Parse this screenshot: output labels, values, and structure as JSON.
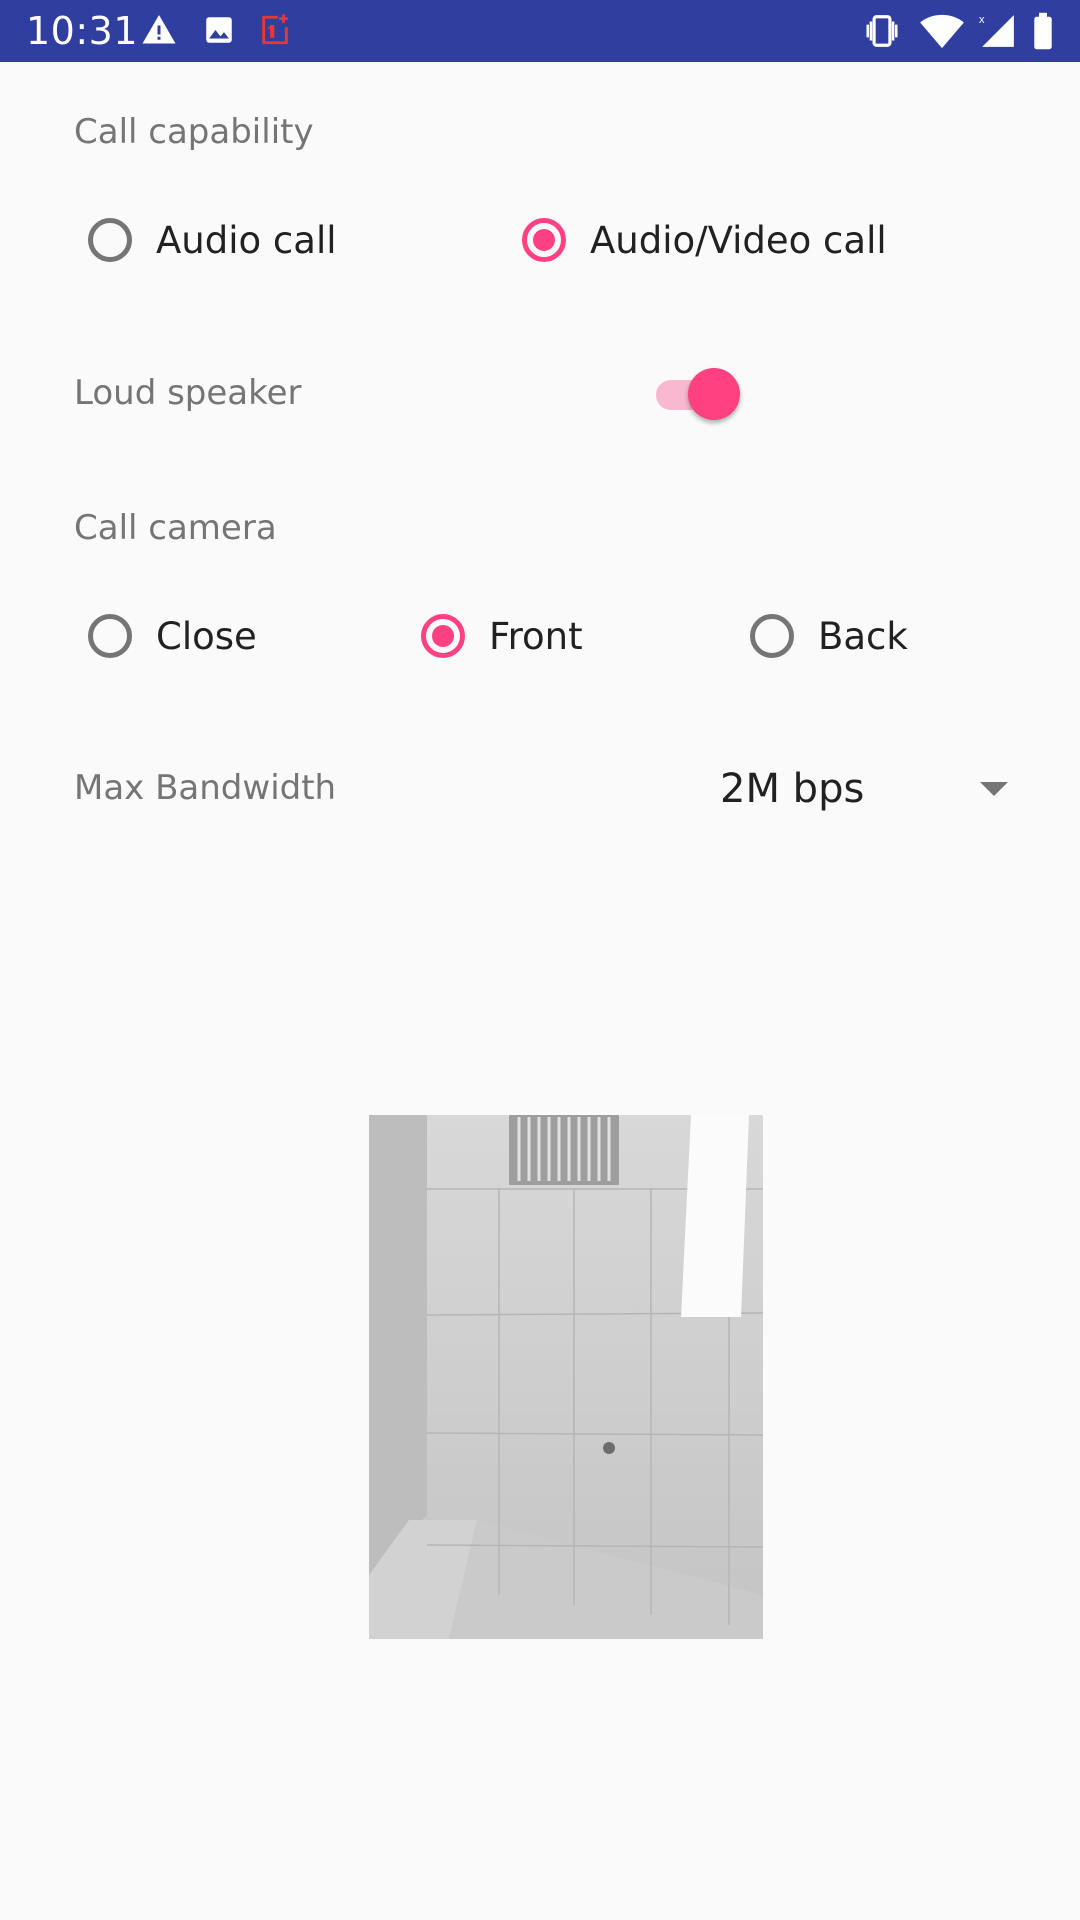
{
  "status_bar": {
    "time": "10:31",
    "background_color": "#303f9f",
    "icons": [
      "warning-icon",
      "image-icon",
      "oneplus-icon",
      "vibrate-icon",
      "wifi-icon",
      "cell-signal-icon",
      "battery-icon"
    ]
  },
  "call_capability": {
    "label": "Call capability",
    "options": [
      {
        "label": "Audio call",
        "selected": false
      },
      {
        "label": "Audio/Video call",
        "selected": true
      }
    ]
  },
  "loud_speaker": {
    "label": "Loud speaker",
    "enabled": true
  },
  "call_camera": {
    "label": "Call camera",
    "options": [
      {
        "label": "Close",
        "selected": false
      },
      {
        "label": "Front",
        "selected": true
      },
      {
        "label": "Back",
        "selected": false
      }
    ]
  },
  "max_bandwidth": {
    "label": "Max Bandwidth",
    "value": "2M bps"
  },
  "colors": {
    "accent": "#ff4081",
    "accent_light": "#f8b8cf",
    "label_gray": "#757575",
    "text_dark": "#212121",
    "background": "#fafafa"
  }
}
